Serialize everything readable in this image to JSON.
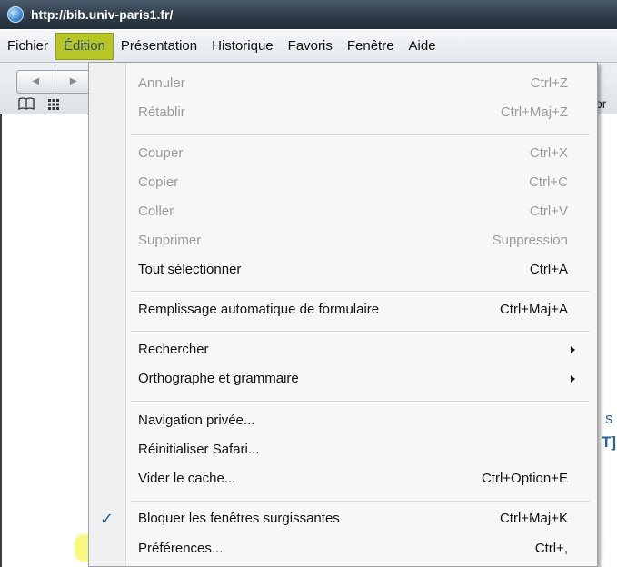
{
  "titlebar": {
    "url": "http://bib.univ-paris1.fr/"
  },
  "menubar": {
    "items": [
      "Fichier",
      "Édition",
      "Présentation",
      "Historique",
      "Favoris",
      "Fenêtre",
      "Aide"
    ]
  },
  "toolbar": {
    "back": "◀",
    "forward": "▶",
    "bookmarks_icon": "book-icon",
    "grid_icon": "grid-icon",
    "right_fragment": "or"
  },
  "page": {
    "fragment_1": "s",
    "fragment_2": "T]"
  },
  "edit_menu": {
    "undo": {
      "label": "Annuler",
      "shortcut": "Ctrl+Z"
    },
    "redo": {
      "label": "Rétablir",
      "shortcut": "Ctrl+Maj+Z"
    },
    "cut": {
      "label": "Couper",
      "shortcut": "Ctrl+X"
    },
    "copy": {
      "label": "Copier",
      "shortcut": "Ctrl+C"
    },
    "paste": {
      "label": "Coller",
      "shortcut": "Ctrl+V"
    },
    "delete": {
      "label": "Supprimer",
      "shortcut": "Suppression"
    },
    "select_all": {
      "label": "Tout sélectionner",
      "shortcut": "Ctrl+A"
    },
    "autofill": {
      "label": "Remplissage automatique de formulaire",
      "shortcut": "Ctrl+Maj+A"
    },
    "find": {
      "label": "Rechercher"
    },
    "spelling": {
      "label": "Orthographe et grammaire"
    },
    "private": {
      "label": "Navigation privée..."
    },
    "reset": {
      "label": "Réinitialiser Safari..."
    },
    "empty_cache": {
      "label": "Vider le cache...",
      "shortcut": "Ctrl+Option+E"
    },
    "block_popups": {
      "label": "Bloquer les fenêtres surgissantes",
      "shortcut": "Ctrl+Maj+K",
      "check": "✓"
    },
    "preferences": {
      "label": "Préférences...",
      "shortcut": "Ctrl+,"
    }
  },
  "colors": {
    "active_menu": "#b8c623",
    "highlight": "#f0f528",
    "check": "#1f5fa8"
  }
}
